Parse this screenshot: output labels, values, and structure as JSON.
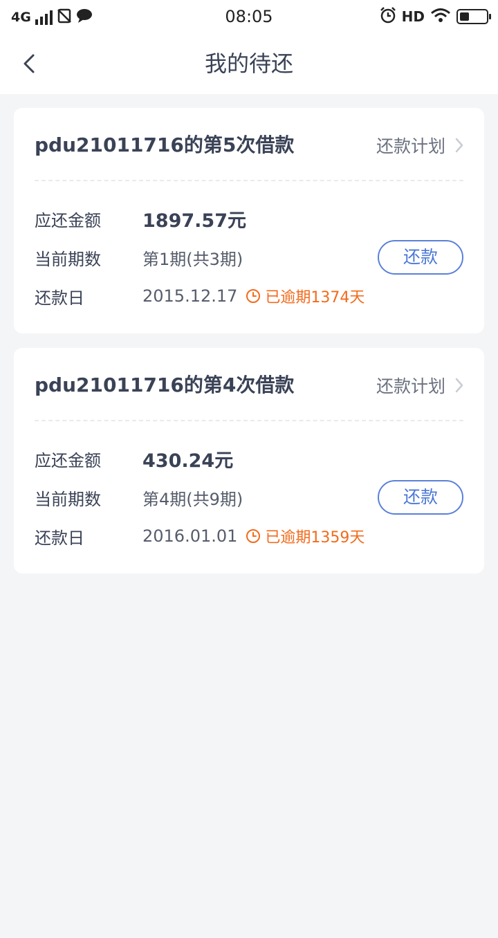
{
  "status_bar": {
    "network": "4G",
    "time": "08:05",
    "hd": "HD",
    "battery_level": 0.35
  },
  "nav": {
    "title": "我的待还"
  },
  "labels": {
    "amount_due": "应还金额",
    "current_period": "当前期数",
    "due_date": "还款日",
    "plan_link": "还款计划",
    "pay_button": "还款"
  },
  "loans": [
    {
      "title": "pdu21011716的第5次借款",
      "amount": "1897.57元",
      "period": "第1期(共3期)",
      "due_date": "2015.12.17",
      "overdue": "已逾期1374天"
    },
    {
      "title": "pdu21011716的第4次借款",
      "amount": "430.24元",
      "period": "第4期(共9期)",
      "due_date": "2016.01.01",
      "overdue": "已逾期1359天"
    }
  ],
  "colors": {
    "accent_blue": "#4d78d6",
    "overdue_orange": "#f26a1b",
    "text_dark": "#3a4256",
    "background": "#f4f5f7"
  }
}
